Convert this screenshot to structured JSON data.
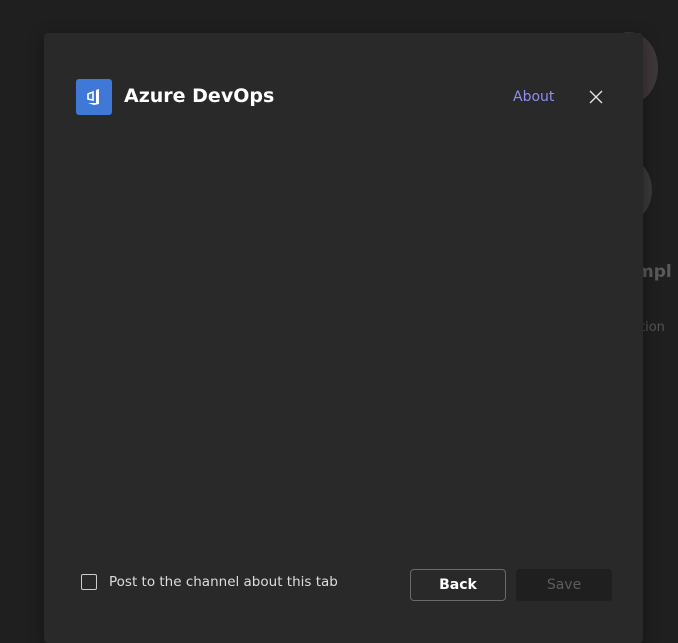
{
  "background": {
    "partial_text_1": "mpl",
    "partial_text_2": "tion"
  },
  "dialog": {
    "title": "Azure DevOps",
    "about_link": "About",
    "checkbox_label": "Post to the channel about this tab",
    "checkbox_checked": false,
    "back_label": "Back",
    "save_label": "Save"
  },
  "colors": {
    "accent": "#3f78d6",
    "link": "#8f8ef2"
  }
}
